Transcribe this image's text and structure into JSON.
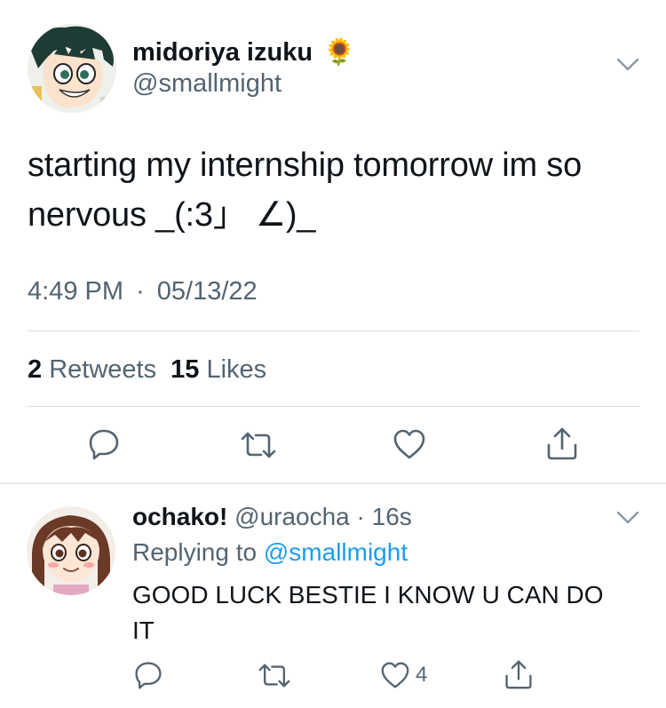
{
  "tweet": {
    "author_name": "midoriya izuku",
    "author_emoji": "🌻",
    "author_handle": "@smallmight",
    "text_line1": "starting my internship tomorrow im so",
    "text_line2": "nervous _(:3」 ∠)_",
    "time": "4:49 PM",
    "separator": "·",
    "date": "05/13/22",
    "retweets_count": "2",
    "retweets_label": "Retweets",
    "likes_count": "15",
    "likes_label": "Likes",
    "actions": [
      "reply-icon",
      "retweet-icon",
      "like-icon",
      "share-icon"
    ]
  },
  "reply": {
    "author_name": "ochako!",
    "author_handle": "@uraocha",
    "separator": "·",
    "age": "16s",
    "replying_prefix": "Replying to",
    "replying_handle": "@smallmight",
    "text_line1": "GOOD LUCK BESTIE I KNOW U CAN DO",
    "text_line2": "IT",
    "like_count": "4",
    "actions": [
      "reply-icon",
      "retweet-icon",
      "like-icon",
      "share-icon"
    ]
  },
  "colors": {
    "text": "#0f1419",
    "secondary": "#536471",
    "link": "#1d9bf0",
    "divider": "#dcdfe2"
  }
}
